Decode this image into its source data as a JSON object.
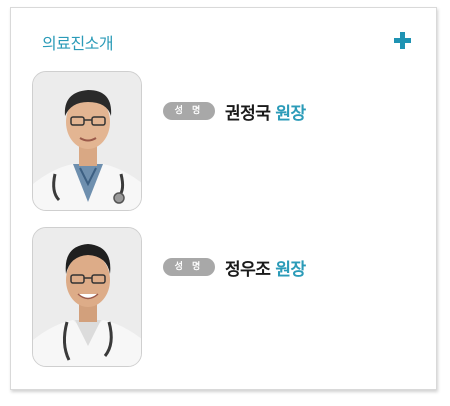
{
  "section": {
    "title": "의료진소개",
    "more_icon": "plus-icon",
    "accent_color": "#2b9bb8"
  },
  "doctors": [
    {
      "badge": "성 명",
      "name": "권정국",
      "title": "원장",
      "photo_icon": "doctor-portrait"
    },
    {
      "badge": "성 명",
      "name": "정우조",
      "title": "원장",
      "photo_icon": "doctor-portrait"
    }
  ]
}
